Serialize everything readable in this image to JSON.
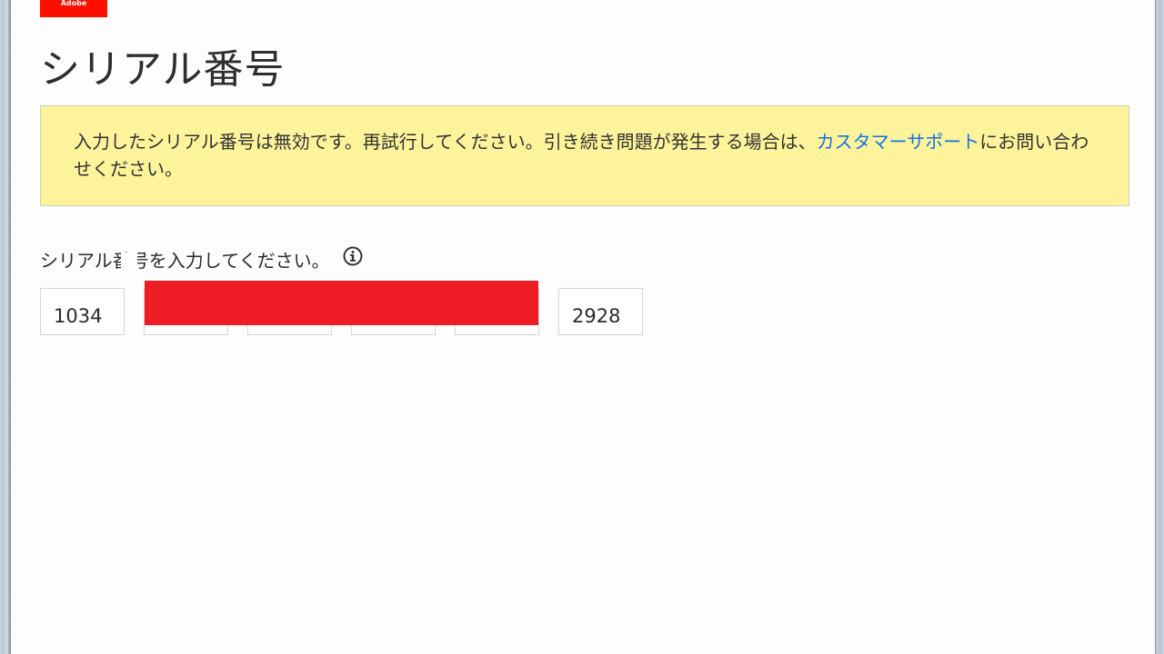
{
  "brand": {
    "logo_text": "Adobe",
    "accent_color": "#fa0f00"
  },
  "page": {
    "title": "シリアル番号"
  },
  "alert": {
    "message_before_link": "入力したシリアル番号は無効です。再試行してください。引き続き問題が発生する場合は、",
    "link_text": "カスタマーサポート",
    "message_after_link": "にお問い合わせください。",
    "background_color": "#fdf39b",
    "link_color": "#1473e6"
  },
  "serial": {
    "label": "シリアル番号を入力してください。",
    "info_icon": "info-icon",
    "fields": [
      {
        "value": "1034"
      },
      {
        "value": ""
      },
      {
        "value": ""
      },
      {
        "value": ""
      },
      {
        "value": ""
      },
      {
        "value": "2928"
      }
    ],
    "redaction_color": "#ee1c24"
  }
}
